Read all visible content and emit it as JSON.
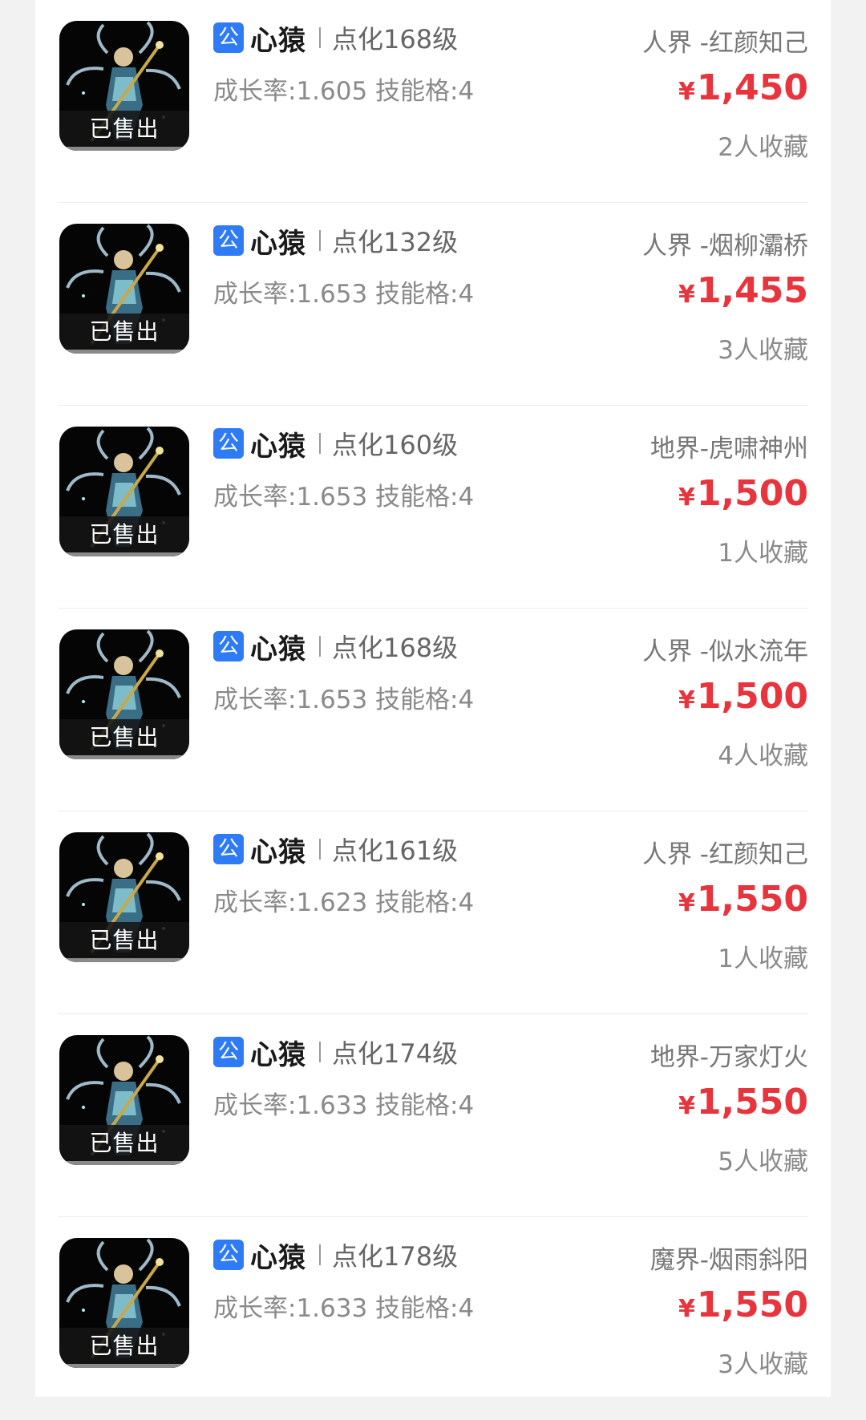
{
  "listings": [
    {
      "badge": "公",
      "name": "心猿",
      "level": "点化168级",
      "stats": "成长率:1.605 技能格:4",
      "server": "人界 -红颜知己",
      "currency": "¥",
      "price": "1,450",
      "favorites": "2人收藏",
      "status": "已售出"
    },
    {
      "badge": "公",
      "name": "心猿",
      "level": "点化132级",
      "stats": "成长率:1.653 技能格:4",
      "server": "人界 -烟柳灞桥",
      "currency": "¥",
      "price": "1,455",
      "favorites": "3人收藏",
      "status": "已售出"
    },
    {
      "badge": "公",
      "name": "心猿",
      "level": "点化160级",
      "stats": "成长率:1.653 技能格:4",
      "server": "地界-虎啸神州",
      "currency": "¥",
      "price": "1,500",
      "favorites": "1人收藏",
      "status": "已售出"
    },
    {
      "badge": "公",
      "name": "心猿",
      "level": "点化168级",
      "stats": "成长率:1.653 技能格:4",
      "server": "人界 -似水流年",
      "currency": "¥",
      "price": "1,500",
      "favorites": "4人收藏",
      "status": "已售出"
    },
    {
      "badge": "公",
      "name": "心猿",
      "level": "点化161级",
      "stats": "成长率:1.623 技能格:4",
      "server": "人界 -红颜知己",
      "currency": "¥",
      "price": "1,550",
      "favorites": "1人收藏",
      "status": "已售出"
    },
    {
      "badge": "公",
      "name": "心猿",
      "level": "点化174级",
      "stats": "成长率:1.633 技能格:4",
      "server": "地界-万家灯火",
      "currency": "¥",
      "price": "1,550",
      "favorites": "5人收藏",
      "status": "已售出"
    },
    {
      "badge": "公",
      "name": "心猿",
      "level": "点化178级",
      "stats": "成长率:1.633 技能格:4",
      "server": "魔界-烟雨斜阳",
      "currency": "¥",
      "price": "1,550",
      "favorites": "3人收藏",
      "status": "已售出"
    }
  ],
  "colors": {
    "price": "#e8343d",
    "badge": "#2f7bf6",
    "background": "#f2f2f2"
  }
}
